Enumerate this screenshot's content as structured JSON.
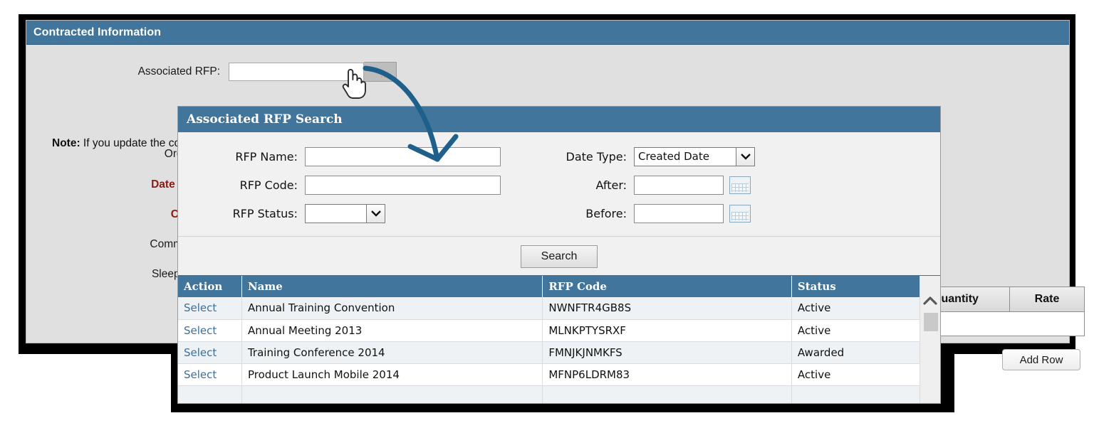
{
  "panel": {
    "title": "Contracted Information",
    "fields": {
      "associated_rfp_label": "Associated RFP:",
      "associated_rfp_value": "",
      "ellipsis_label": "...",
      "organization_label": "Organization:",
      "date_contracted_label": "Date Contracted:",
      "currency_label": "Currency:",
      "commission_rate_label": "Commission Rate:",
      "sleeping_rooms_label": "Sleeping Rooms:"
    },
    "note_prefix": "Note:",
    "note_text": " If you update the contracted information here, it will not be updated in the associated RFP.",
    "mini_grid": {
      "headers": [
        "Quantity",
        "Rate"
      ],
      "row_value": ""
    },
    "add_row_label": "Add Row"
  },
  "dialog": {
    "title": "Associated RFP Search",
    "form": {
      "rfp_name_label": "RFP Name:",
      "rfp_name_value": "",
      "rfp_code_label": "RFP Code:",
      "rfp_code_value": "",
      "rfp_status_label": "RFP Status:",
      "rfp_status_value": "",
      "date_type_label": "Date Type:",
      "date_type_value": "Created Date",
      "after_label": "After:",
      "after_value": "",
      "before_label": "Before:",
      "before_value": ""
    },
    "search_button_label": "Search",
    "results": {
      "columns": [
        "Action",
        "Name",
        "RFP Code",
        "Status"
      ],
      "rows": [
        {
          "action": "Select",
          "name": "Annual Training Convention",
          "code": "NWNFTR4GB8S",
          "status": "Active"
        },
        {
          "action": "Select",
          "name": "Annual Meeting 2013",
          "code": "MLNKPTYSRXF",
          "status": "Active"
        },
        {
          "action": "Select",
          "name": "Training Conference 2014",
          "code": "FMNJKJNMKFS",
          "status": "Awarded"
        },
        {
          "action": "Select",
          "name": "Product Launch Mobile 2014",
          "code": "MFNP6LDRM83",
          "status": "Active"
        },
        {
          "action": "",
          "name": "",
          "code": "",
          "status": ""
        }
      ]
    },
    "scrollbar": {
      "up_arrow": "⌃"
    }
  },
  "colors": {
    "header_blue": "#42759b",
    "panel_gray": "#e0e0e0",
    "required_red": "#8b1a14",
    "link_blue": "#3c6f9c",
    "annotation_blue": "#1f5f8b"
  }
}
